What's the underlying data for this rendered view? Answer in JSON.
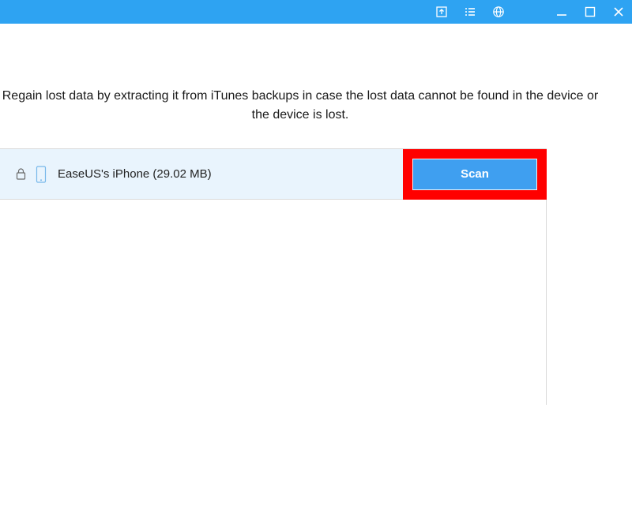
{
  "titlebar": {
    "icons": {
      "update": "update-icon",
      "list": "list-icon",
      "globe": "globe-icon",
      "minimize": "minimize-icon",
      "maximize": "maximize-icon",
      "close": "close-icon"
    }
  },
  "main": {
    "description": "Regain lost data by extracting it from iTunes backups in case the lost data cannot be found in the device or the device is lost."
  },
  "backup": {
    "locked": true,
    "device_label": "EaseUS's iPhone (29.02 MB)",
    "scan_label": "Scan"
  }
}
